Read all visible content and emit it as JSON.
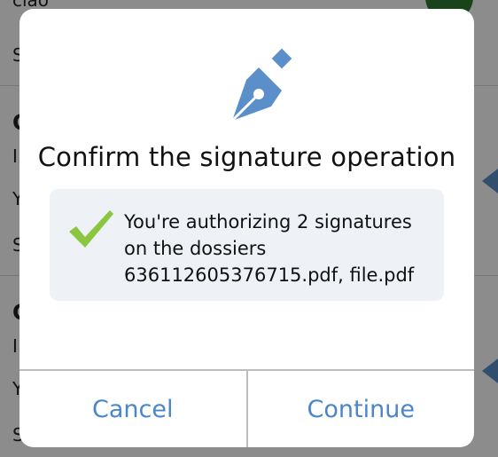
{
  "background": {
    "top_fragment": "ciao",
    "row_fragments": [
      "S",
      "C",
      "I",
      "Y",
      "S",
      "C",
      "I",
      "Y",
      "S"
    ]
  },
  "dialog": {
    "icon": "fountain-pen-icon",
    "title": "Confirm the signature operation",
    "message": {
      "icon": "checkmark-icon",
      "line1": "You're authorizing 2 signatures",
      "line2": "on the dossiers",
      "line3": "636112605376715.pdf, file.pdf"
    },
    "buttons": {
      "cancel": "Cancel",
      "continue": "Continue"
    },
    "colors": {
      "accent": "#4a86c8",
      "icon": "#5b8fc9",
      "check": "#8cc63f",
      "info_bg": "#eef2f6"
    }
  }
}
